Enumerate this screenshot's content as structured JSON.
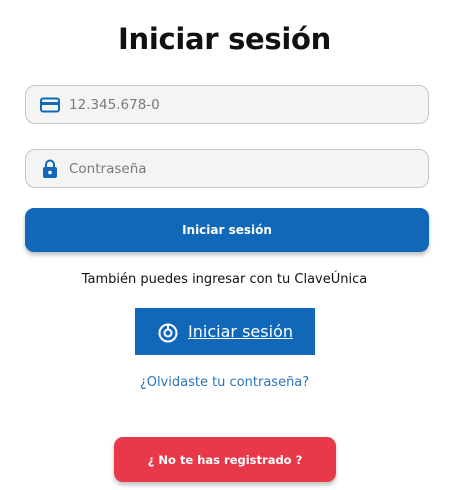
{
  "page": {
    "title": "Iniciar sesión"
  },
  "form": {
    "rut_field": {
      "placeholder": "12.345.678-0",
      "icon": "credit-card-icon"
    },
    "password_field": {
      "placeholder": "Contraseña",
      "icon": "lock-icon"
    },
    "login_button_label": "Iniciar sesión"
  },
  "clave_unica": {
    "prompt": "También puedes ingresar con tu ClaveÚnica",
    "button_label": "Iniciar sesión",
    "icon": "clave-unica-icon"
  },
  "links": {
    "forgot_password": "¿Olvidaste tu contraseña?"
  },
  "register": {
    "button_label": "¿ No te has registrado ?"
  },
  "colors": {
    "primary": "#1168b8",
    "danger": "#e8394a",
    "link": "#2b73b8",
    "field_bg": "#f4f4f4"
  }
}
